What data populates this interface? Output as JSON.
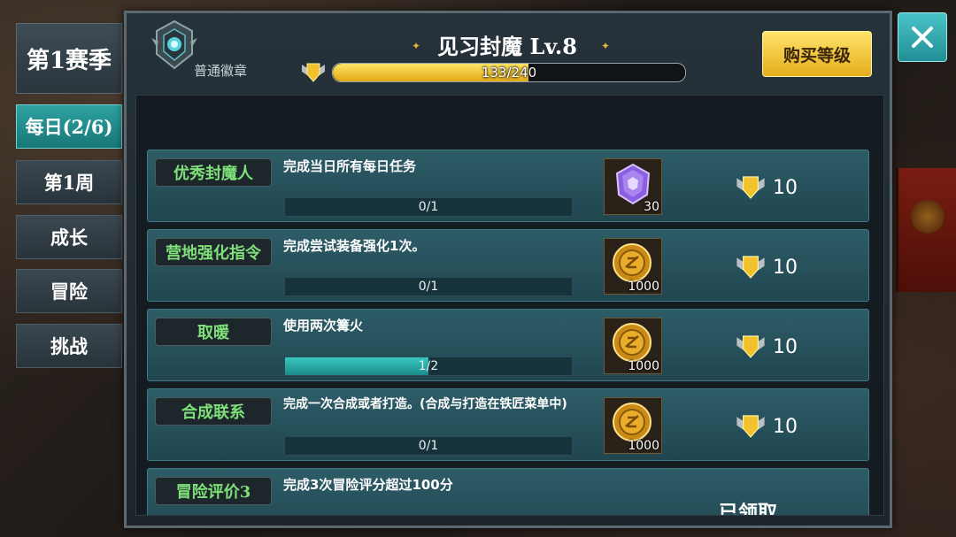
{
  "sidebar": {
    "season": "第1赛季",
    "tabs": [
      {
        "label": "每日(2/6)",
        "active": true
      },
      {
        "label": "第1周",
        "active": false
      },
      {
        "label": "成长",
        "active": false
      },
      {
        "label": "冒险",
        "active": false
      },
      {
        "label": "挑战",
        "active": false
      }
    ]
  },
  "header": {
    "badge_label": "普通徽章",
    "title": "见习封魔  Lv.8",
    "xp": {
      "text": "133/240",
      "current": 133,
      "max": 240
    },
    "buy_label": "购买等级"
  },
  "tasks": [
    {
      "tag": "优秀封魔人",
      "desc": "完成当日所有每日任务",
      "progress_text": "0/1",
      "progress": 0.0,
      "reward_icon": "purple-gem-icon",
      "reward_count": "30",
      "points": "10",
      "claimed": false
    },
    {
      "tag": "营地强化指令",
      "desc": "完成尝试装备强化1次。",
      "progress_text": "0/1",
      "progress": 0.0,
      "reward_icon": "gold-coin-icon",
      "reward_count": "1000",
      "points": "10",
      "claimed": false
    },
    {
      "tag": "取暖",
      "desc": "使用两次篝火",
      "progress_text": "1/2",
      "progress": 0.5,
      "reward_icon": "gold-coin-icon",
      "reward_count": "1000",
      "points": "10",
      "claimed": false
    },
    {
      "tag": "合成联系",
      "desc": "完成一次合成或者打造。(合成与打造在铁匠菜单中)",
      "progress_text": "0/1",
      "progress": 0.0,
      "reward_icon": "gold-coin-icon",
      "reward_count": "1000",
      "points": "10",
      "claimed": false
    },
    {
      "tag": "冒险评价3",
      "desc": "完成3次冒险评分超过100分",
      "claimed": true,
      "claimed_label": "已领取"
    }
  ],
  "colors": {
    "accent": "#2fa1a1",
    "gold": "#f2c22c",
    "tag_text": "#7fe07a"
  }
}
